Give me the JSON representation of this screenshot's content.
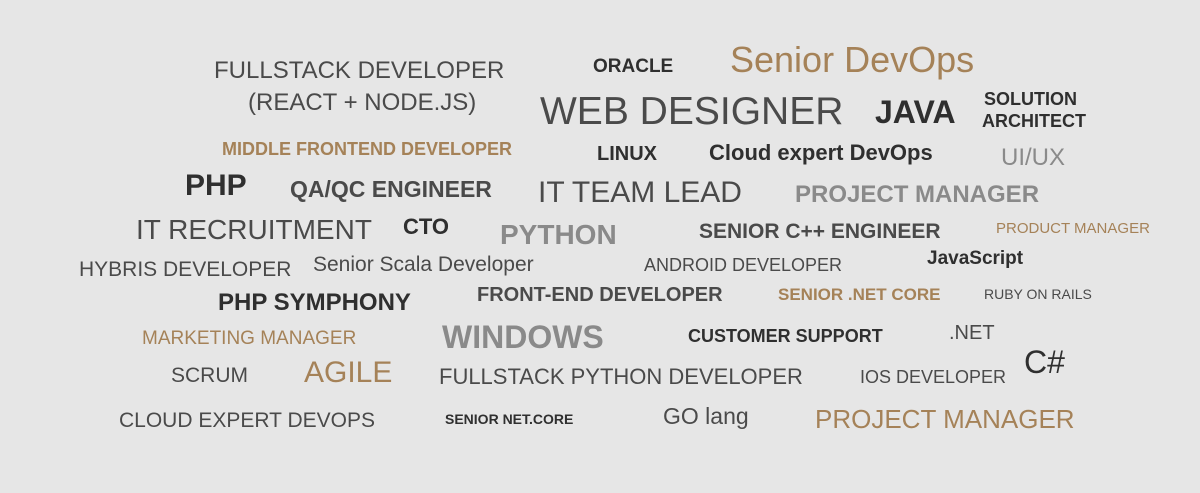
{
  "colors": {
    "background": "#e6e6e6",
    "dark": "#2f2f2f",
    "gray": "#8a8a8a",
    "gold": "#a58258"
  },
  "words": {
    "fullstack_dev": "FULLSTACK DEVELOPER",
    "fullstack_dev_sub": "(REACT + NODE.JS)",
    "oracle": "ORACLE",
    "senior_devops": "Senior DevOps",
    "web_designer": "WEB DESIGNER",
    "java": "JAVA",
    "solution": "SOLUTION",
    "architect": "ARCHITECT",
    "middle_frontend": "MIDDLE FRONTEND DEVELOPER",
    "linux": "LINUX",
    "cloud_expert_devops": "Cloud expert DevOps",
    "ui_ux": "UI/UX",
    "php": "PHP",
    "qa_qc": "QA/QC ENGINEER",
    "it_team_lead": "IT TEAM LEAD",
    "project_manager_gray": "PROJECT MANAGER",
    "it_recruitment": "IT RECRUITMENT",
    "cto": "CTO",
    "python": "PYTHON",
    "senior_cpp": "SENIOR C++ ENGINEER",
    "product_manager": "PRODUCT MANAGER",
    "hybris": "HYBRIS DEVELOPER",
    "senior_scala": "Senior Scala Developer",
    "android": "ANDROID DEVELOPER",
    "javascript": "JavaScript",
    "php_symphony": "PHP SYMPHONY",
    "front_end": "FRONT-END DEVELOPER",
    "senior_net_core": "SENIOR .NET CORE",
    "ruby": "RUBY ON RAILS",
    "marketing": "MARKETING MANAGER",
    "windows": "WINDOWS",
    "customer_support": "CUSTOMER SUPPORT",
    "dotnet": ".NET",
    "csharp": "C#",
    "scrum": "SCRUM",
    "agile": "AGILE",
    "fullstack_python": "FULLSTACK PYTHON DEVELOPER",
    "ios": "IOS DEVELOPER",
    "cloud_expert_devops_caps": "CLOUD EXPERT DEVOPS",
    "senior_netcore2": "SENIOR NET.CORE",
    "golang": "GO lang",
    "project_manager_gold": "PROJECT MANAGER"
  }
}
